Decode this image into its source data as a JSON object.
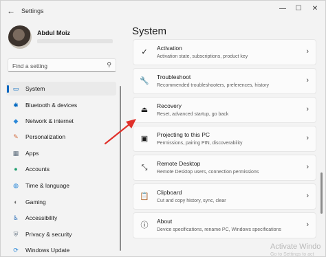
{
  "window": {
    "title": "Settings",
    "back_icon": "←",
    "minimize_icon": "—",
    "maximize_icon": "☐",
    "close_icon": "✕"
  },
  "profile": {
    "name": "Abdul Moiz"
  },
  "search": {
    "placeholder": "Find a setting",
    "icon": "⚲"
  },
  "sidebar": {
    "items": [
      {
        "label": "System",
        "icon": "▭",
        "icon_name": "monitor-icon",
        "color": "#0067c0",
        "selected": true
      },
      {
        "label": "Bluetooth & devices",
        "icon": "✱",
        "icon_name": "bluetooth-icon",
        "color": "#0067c0"
      },
      {
        "label": "Network & internet",
        "icon": "◆",
        "icon_name": "wifi-icon",
        "color": "#2b88d8"
      },
      {
        "label": "Personalization",
        "icon": "✎",
        "icon_name": "brush-icon",
        "color": "#d16a3c"
      },
      {
        "label": "Apps",
        "icon": "▦",
        "icon_name": "apps-icon",
        "color": "#5a6a7a"
      },
      {
        "label": "Accounts",
        "icon": "●",
        "icon_name": "person-icon",
        "color": "#1f9e6e"
      },
      {
        "label": "Time & language",
        "icon": "◍",
        "icon_name": "globe-clock-icon",
        "color": "#2b88d8"
      },
      {
        "label": "Gaming",
        "icon": "◐",
        "icon_name": "gamepad-icon",
        "color": "#6b6b6b"
      },
      {
        "label": "Accessibility",
        "icon": "♿",
        "icon_name": "accessibility-icon",
        "color": "#2b6fb8"
      },
      {
        "label": "Privacy & security",
        "icon": "⛨",
        "icon_name": "shield-icon",
        "color": "#5a6a7a"
      },
      {
        "label": "Windows Update",
        "icon": "⟳",
        "icon_name": "windows-update-icon",
        "color": "#2b88d8"
      }
    ]
  },
  "main": {
    "title": "System",
    "cards": [
      {
        "title": "Activation",
        "desc": "Activation state, subscriptions, product key",
        "icon": "✓",
        "icon_name": "check-circle-icon"
      },
      {
        "title": "Troubleshoot",
        "desc": "Recommended troubleshooters, preferences, history",
        "icon": "🔧",
        "icon_name": "wrench-icon"
      },
      {
        "title": "Recovery",
        "desc": "Reset, advanced startup, go back",
        "icon": "⏏",
        "icon_name": "recovery-icon"
      },
      {
        "title": "Projecting to this PC",
        "desc": "Permissions, pairing PIN, discoverability",
        "icon": "▣",
        "icon_name": "project-icon"
      },
      {
        "title": "Remote Desktop",
        "desc": "Remote Desktop users, connection permissions",
        "icon": "⤡",
        "icon_name": "remote-desktop-icon"
      },
      {
        "title": "Clipboard",
        "desc": "Cut and copy history, sync, clear",
        "icon": "📋",
        "icon_name": "clipboard-icon"
      },
      {
        "title": "About",
        "desc": "Device specifications, rename PC, Windows specifications",
        "icon": "ⓘ",
        "icon_name": "info-icon"
      }
    ],
    "chevron": "›"
  },
  "watermark": {
    "title": "Activate Windo",
    "subtitle": "Go to Settings to act"
  },
  "colors": {
    "accent": "#0067c0",
    "annotation_arrow": "#e0302a"
  }
}
